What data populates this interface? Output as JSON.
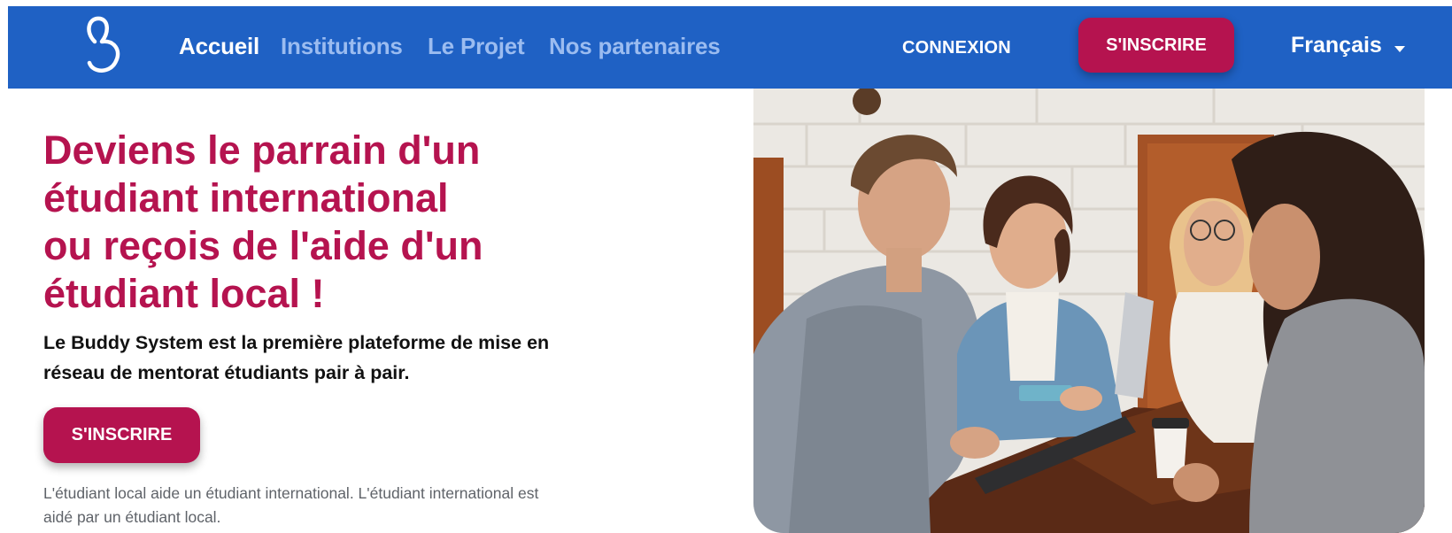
{
  "navbar": {
    "logo_icon": "buddy-system-logo-icon",
    "links": [
      {
        "label": "Accueil",
        "active": true
      },
      {
        "label": "Institutions",
        "active": false
      },
      {
        "label": "Le Projet",
        "active": false
      },
      {
        "label": "Nos partenaires",
        "active": false
      }
    ],
    "login_label": "CONNEXION",
    "signup_label": "S'INSCRIRE",
    "language": {
      "selected": "Français",
      "icon": "caret-down-icon"
    }
  },
  "hero": {
    "title_lines": [
      "Deviens le parrain d'un",
      "étudiant international",
      "ou reçois de l'aide d'un",
      "étudiant local !"
    ],
    "subtitle_lines": [
      "Le Buddy System est la première plateforme de mise en",
      "réseau de mentorat étudiants pair à pair."
    ],
    "signup_label": "S'INSCRIRE",
    "note_lines": [
      "L'étudiant local aide un étudiant international. L'étudiant international est",
      "aidé par un étudiant local."
    ]
  },
  "colors": {
    "navbar_bg": "#1f61c4",
    "nav_link_inactive": "#9bbcf0",
    "nav_link_active": "#ffffff",
    "accent": "#b5134f",
    "subtitle_text": "#111111",
    "note_text": "#5f6369"
  }
}
